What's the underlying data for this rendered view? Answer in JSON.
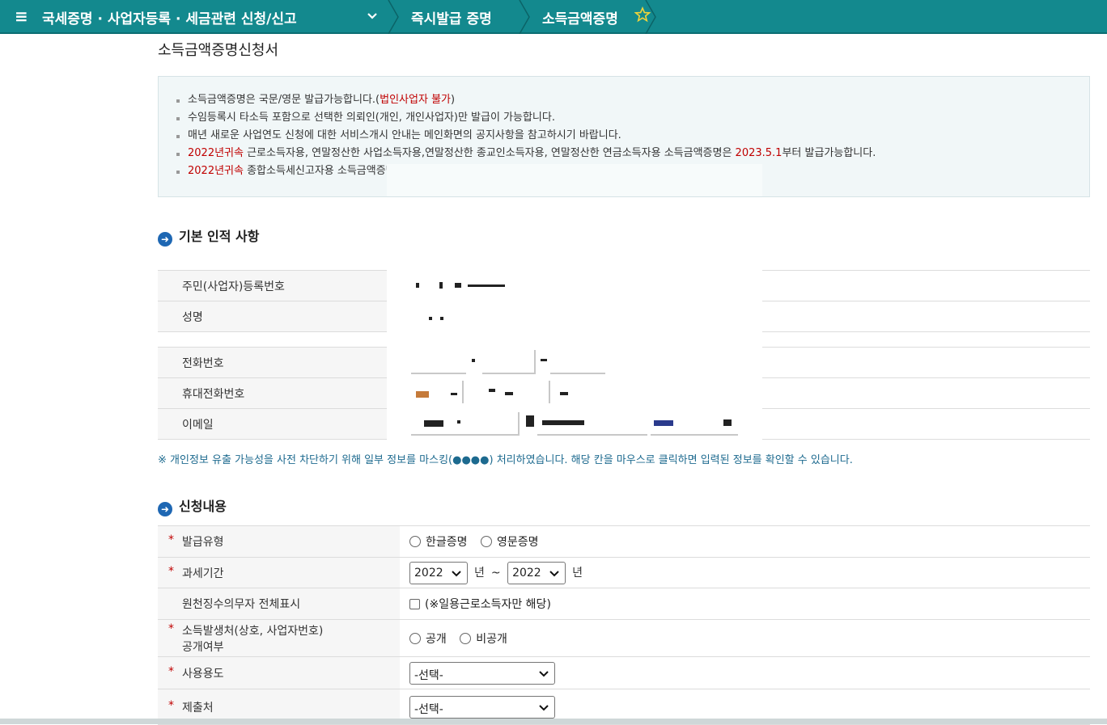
{
  "nav": {
    "crumb1": "국세증명 · 사업자등록 · 세금관련 신청/신고",
    "crumb2": "즉시발급 증명",
    "crumb3": "소득금액증명"
  },
  "page_title": "소득금액증명신청서",
  "notice": {
    "l1_a": "소득금액증명은 국문/영문 발급가능합니다.(",
    "l1_red": "법인사업자 불가",
    "l1_b": ")",
    "l2": "수임등록시 타소득 포함으로 선택한 의뢰인(개인, 개인사업자)만 발급이 가능합니다.",
    "l3": "매년 새로운 사업연도 신청에 대한 서비스개시 안내는 메인화면의 공지사항을 참고하시기 바랍니다.",
    "l4_red1": "2022년귀속",
    "l4_a": " 근로소득자용, 연말정산한 사업소득자용,연말정산한 종교인소득자용, 연말정산한 연금소득자용 소득금액증명은 ",
    "l4_red2": "2023.5.1",
    "l4_b": "부터 발급가능합니다.",
    "l5_red": "2022년귀속",
    "l5_a": " 종합소득세신고자용 소득금액증명은 "
  },
  "section1": {
    "title": "기본 인적 사항"
  },
  "basic": {
    "rows1": [
      {
        "label": "주민(사업자)등록번호"
      },
      {
        "label": "성명"
      }
    ],
    "rows2": [
      {
        "label": "전화번호"
      },
      {
        "label": "휴대전화번호"
      },
      {
        "label": "이메일"
      }
    ]
  },
  "privacy_note": "※ 개인정보 유출 가능성을 사전 차단하기 위해 일부 정보를 마스킹(●●●●) 처리하였습니다. 해당 칸을 마우스로 클릭하면 입력된 정보를 확인할 수 있습니다.",
  "section2": {
    "title": "신청내용"
  },
  "apply": {
    "issue_type": {
      "label": "발급유형",
      "opt1": "한글증명",
      "opt2": "영문증명"
    },
    "period": {
      "label": "과세기간",
      "from": "2022",
      "to": "2022",
      "unit": "년",
      "tilde": "~"
    },
    "withholding": {
      "label": "원천징수의무자 전체표시",
      "note": "(※일용근로소득자만 해당)"
    },
    "disclosure": {
      "label1": "소득발생처(상호, 사업자번호)",
      "label2": "공개여부",
      "opt1": "공개",
      "opt2": "비공개"
    },
    "purpose": {
      "label": "사용용도",
      "value": "-선택-"
    },
    "submit_to": {
      "label": "제출처",
      "value": "-선택-"
    }
  },
  "colors": {
    "nav_bg": "#13898e",
    "accent_red": "#c00000",
    "section_icon": "#1e67b3",
    "privacy_text": "#1d6a8f"
  }
}
